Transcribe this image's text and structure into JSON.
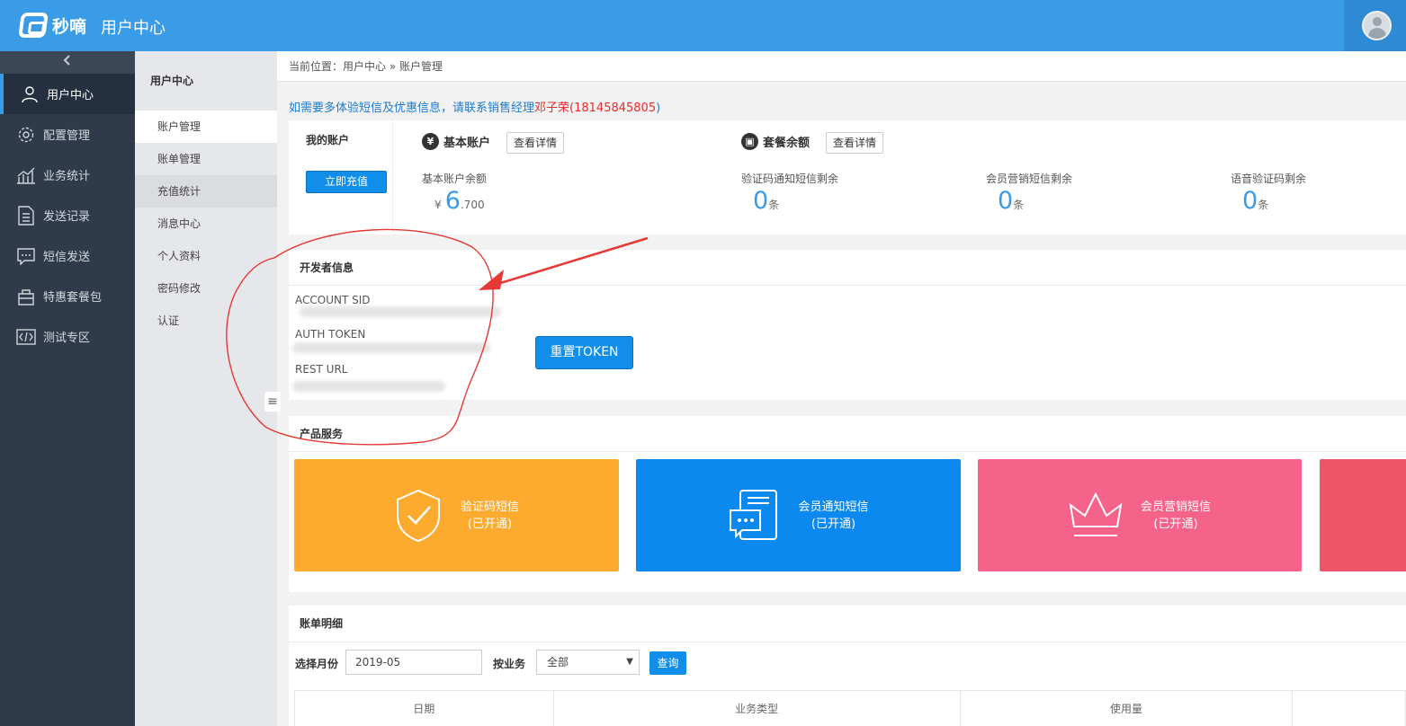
{
  "header": {
    "logo_text": "秒嘀",
    "app_title": "用户中心"
  },
  "sidebar": {
    "items": [
      {
        "label": "用户中心",
        "icon": "user-icon",
        "active": true
      },
      {
        "label": "配置管理",
        "icon": "gear-icon",
        "active": false
      },
      {
        "label": "业务统计",
        "icon": "chart-icon",
        "active": false
      },
      {
        "label": "发送记录",
        "icon": "document-icon",
        "active": false
      },
      {
        "label": "短信发送",
        "icon": "message-icon",
        "active": false
      },
      {
        "label": "特惠套餐包",
        "icon": "bag-icon",
        "active": false
      },
      {
        "label": "测试专区",
        "icon": "code-icon",
        "active": false
      }
    ]
  },
  "subnav": {
    "title": "用户中心",
    "items": [
      "账户管理",
      "账单管理",
      "充值统计",
      "消息中心",
      "个人资料",
      "密码修改",
      "认证"
    ]
  },
  "breadcrumb": "当前位置：用户中心 » 账户管理",
  "notice": {
    "prefix": "如需要多体验短信及优惠信息，请联系销售经理",
    "name": "邓子荣",
    "phone_open": "(",
    "phone": "18145845805",
    "phone_close": ")"
  },
  "account": {
    "my_account": "我的账户",
    "recharge_label": "立即充值",
    "basic_title": "基本账户",
    "basic_icon": "yen-icon",
    "package_title": "套餐余额",
    "package_icon": "gift-icon",
    "detail_label": "查看详情",
    "balance_label": "基本账户余额",
    "balance_currency": "¥",
    "balance_int": "6",
    "balance_dec": ".700",
    "stats": [
      {
        "label": "验证码通知短信剩余",
        "value": "0",
        "unit": "条"
      },
      {
        "label": "会员营销短信剩余",
        "value": "0",
        "unit": "条"
      },
      {
        "label": "语音验证码剩余",
        "value": "0",
        "unit": "条"
      }
    ]
  },
  "developer": {
    "title": "开发者信息",
    "fields": [
      "ACCOUNT SID",
      "AUTH TOKEN",
      "REST URL"
    ],
    "reset_label": "重置TOKEN"
  },
  "products": {
    "title": "产品服务",
    "tiles": [
      {
        "name": "验证码短信",
        "status": "(已开通)",
        "color": "#fdab2e",
        "icon": "shield-check-icon"
      },
      {
        "name": "会员通知短信",
        "status": "(已开通)",
        "color": "#0b89ee",
        "icon": "chat-notice-icon"
      },
      {
        "name": "会员营销短信",
        "status": "(已开通)",
        "color": "#f5628a",
        "icon": "crown-icon"
      }
    ]
  },
  "billing": {
    "title": "账单明细",
    "month_label": "选择月份",
    "month_value": "2019-05",
    "business_label": "按业务",
    "business_value": "全部",
    "query_label": "查询",
    "columns": [
      "日期",
      "业务类型",
      "使用量"
    ]
  },
  "colors": {
    "primary": "#3a9be6",
    "sidebar": "#2f3b4a",
    "annotation": "#e53935"
  }
}
